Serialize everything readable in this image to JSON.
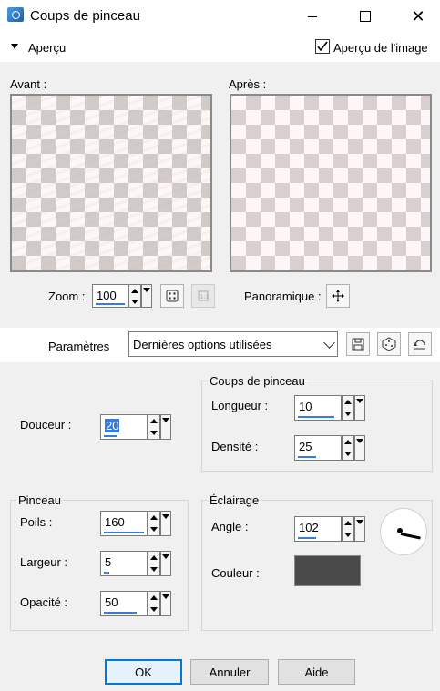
{
  "window": {
    "title": "Coups de pinceau"
  },
  "preview_toggle": {
    "label": "Aperçu",
    "show_image_label": "Aperçu de l'image",
    "show_image_checked": true
  },
  "previews": {
    "before_label": "Avant :",
    "after_label": "Après :"
  },
  "zoom": {
    "label": "Zoom :",
    "value": "100"
  },
  "pan": {
    "label": "Panoramique :"
  },
  "params": {
    "label": "Paramètres",
    "selected": "Dernières options utilisées"
  },
  "softness": {
    "label": "Douceur :",
    "value": "20"
  },
  "strokes_group": {
    "title": "Coups de pinceau",
    "length_label": "Longueur :",
    "length_value": "10",
    "density_label": "Densité :",
    "density_value": "25"
  },
  "brush_group": {
    "title": "Pinceau",
    "bristles_label": "Poils :",
    "bristles_value": "160",
    "width_label": "Largeur :",
    "width_value": "5",
    "opacity_label": "Opacité :",
    "opacity_value": "50"
  },
  "lighting_group": {
    "title": "Éclairage",
    "angle_label": "Angle :",
    "angle_value": "102",
    "color_label": "Couleur :",
    "color_hex": "#4a4a4a"
  },
  "buttons": {
    "ok": "OK",
    "cancel": "Annuler",
    "help": "Aide"
  },
  "icons": [
    "app-icon",
    "minimize-icon",
    "maximize-icon",
    "close-icon",
    "collapse-triangle-icon",
    "checkbox-check-icon",
    "randomize-dice-icon",
    "actual-size-icon",
    "pan-move-icon",
    "save-preset-icon",
    "randomize-dice-icon",
    "reset-icon",
    "dropdown-chevron-icon"
  ]
}
